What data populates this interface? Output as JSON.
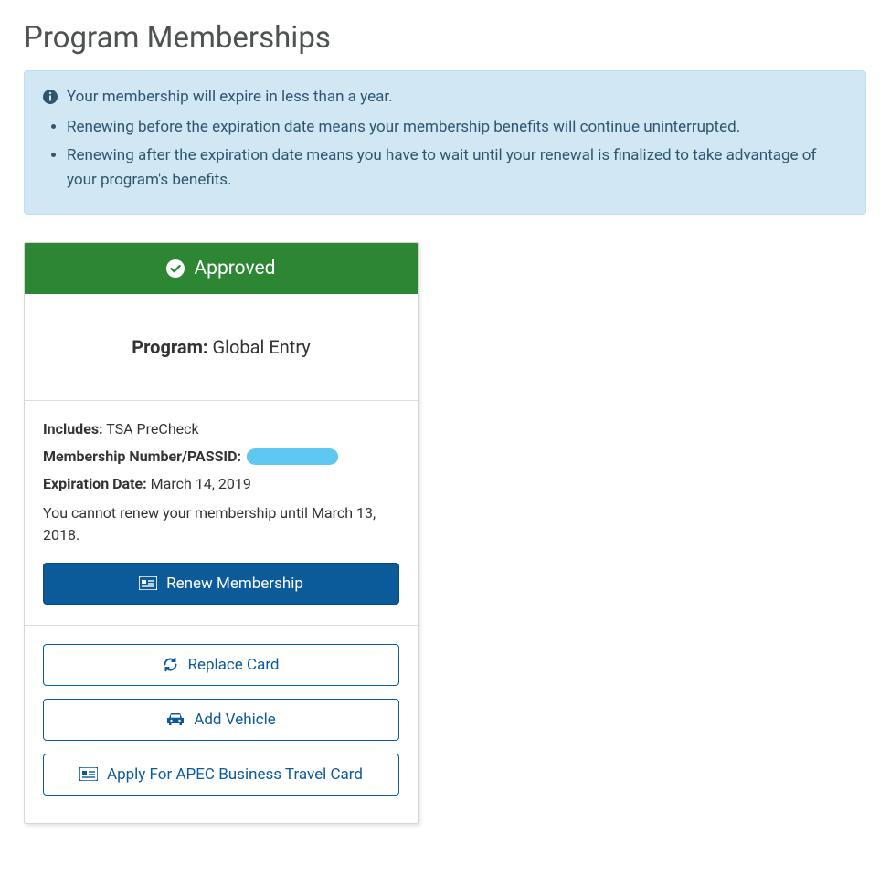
{
  "page": {
    "title": "Program Memberships"
  },
  "alert": {
    "headline": "Your membership will expire in less than a year.",
    "bullets": [
      "Renewing before the expiration date means your membership benefits will continue uninterrupted.",
      "Renewing after the expiration date means you have to wait until your renewal is finalized to take advantage of your program's benefits."
    ]
  },
  "card": {
    "status": "Approved",
    "program_label": "Program:",
    "program_name": "Global Entry",
    "includes_label": "Includes:",
    "includes_value": "TSA PreCheck",
    "passid_label": "Membership Number/PASSID:",
    "passid_value_redacted": true,
    "expiration_label": "Expiration Date:",
    "expiration_value": "March 14, 2019",
    "renew_note": "You cannot renew your membership until March 13, 2018.",
    "buttons": {
      "renew": "Renew Membership",
      "replace": "Replace Card",
      "add_vehicle": "Add Vehicle",
      "apec": "Apply For APEC Business Travel Card"
    }
  },
  "colors": {
    "alert_bg": "#d1e7f3",
    "alert_text": "#2f556f",
    "status_bg": "#2d8634",
    "primary": "#0b5a99"
  }
}
